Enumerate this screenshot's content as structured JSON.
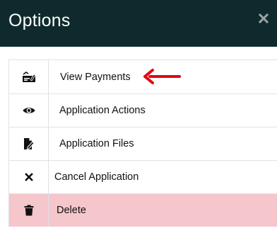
{
  "modal": {
    "title": "Options",
    "close_icon": "close-icon"
  },
  "menu": {
    "items": [
      {
        "label": "View Payments",
        "icon": "payment-check-icon"
      },
      {
        "label": "Application Actions",
        "icon": "eye-icon"
      },
      {
        "label": "Application Files",
        "icon": "file-edit-icon"
      },
      {
        "label": "Cancel Application",
        "icon": "times-icon"
      },
      {
        "label": "Delete",
        "icon": "trash-icon"
      }
    ]
  },
  "annotation": {
    "icon": "red-arrow-icon",
    "color": "#e30613"
  },
  "colors": {
    "header_bg": "#0f2a2c",
    "danger_bg": "#f5c6cb",
    "border": "#dee2e6"
  }
}
